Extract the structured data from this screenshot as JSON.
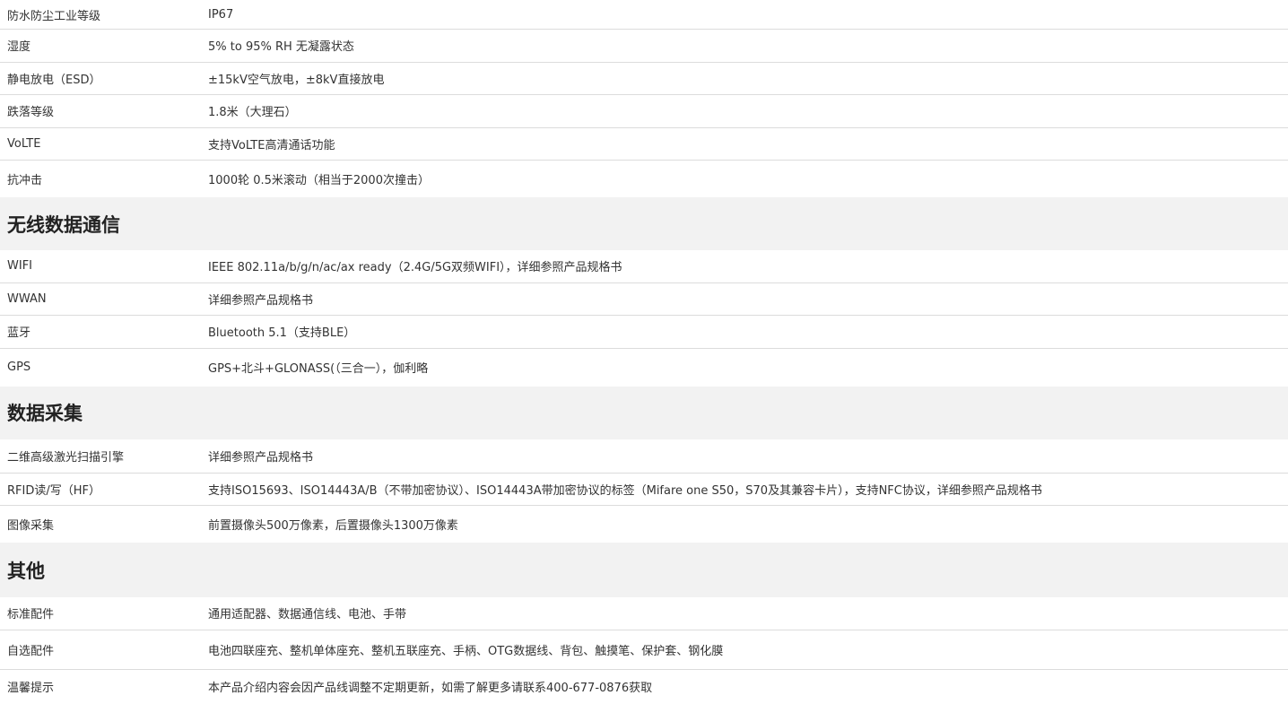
{
  "group_top": {
    "rows": [
      {
        "label": "防水防尘工业等级",
        "value": "IP67"
      },
      {
        "label": "湿度",
        "value": "5% to 95% RH 无凝露状态"
      },
      {
        "label": "静电放电（ESD）",
        "value": "±15kV空气放电，±8kV直接放电"
      },
      {
        "label": "跌落等级",
        "value": "1.8米（大理石）"
      },
      {
        "label": "VoLTE",
        "value": "支持VoLTE高清通话功能"
      },
      {
        "label": "抗冲击",
        "value": "1000轮 0.5米滚动（相当于2000次撞击）"
      }
    ]
  },
  "wireless": {
    "title": "无线数据通信",
    "rows": [
      {
        "label": "WIFI",
        "value": "IEEE 802.11a/b/g/n/ac/ax ready（2.4G/5G双频WIFI），详细参照产品规格书"
      },
      {
        "label": "WWAN",
        "value": "详细参照产品规格书"
      },
      {
        "label": "蓝牙",
        "value": "Bluetooth 5.1（支持BLE）"
      },
      {
        "label": "GPS",
        "value": "GPS+北斗+GLONASS(（三合一），伽利略"
      }
    ]
  },
  "capture": {
    "title": "数据采集",
    "rows": [
      {
        "label": "二维高级激光扫描引擎",
        "value": "详细参照产品规格书"
      },
      {
        "label": "RFID读/写（HF）",
        "value": "支持ISO15693、ISO14443A/B（不带加密协议）、ISO14443A带加密协议的标签（Mifare one S50，S70及其兼容卡片），支持NFC协议，详细参照产品规格书"
      },
      {
        "label": "图像采集",
        "value": "前置摄像头500万像素，后置摄像头1300万像素"
      }
    ]
  },
  "other": {
    "title": "其他",
    "rows": [
      {
        "label": "标准配件",
        "value": "通用适配器、数据通信线、电池、手带"
      },
      {
        "label": "自选配件",
        "value": "电池四联座充、整机单体座充、整机五联座充、手柄、OTG数据线、背包、触摸笔、保护套、钢化膜"
      },
      {
        "label": "温馨提示",
        "value": "本产品介绍内容会因产品线调整不定期更新，如需了解更多请联系400-677-0876获取"
      }
    ]
  }
}
